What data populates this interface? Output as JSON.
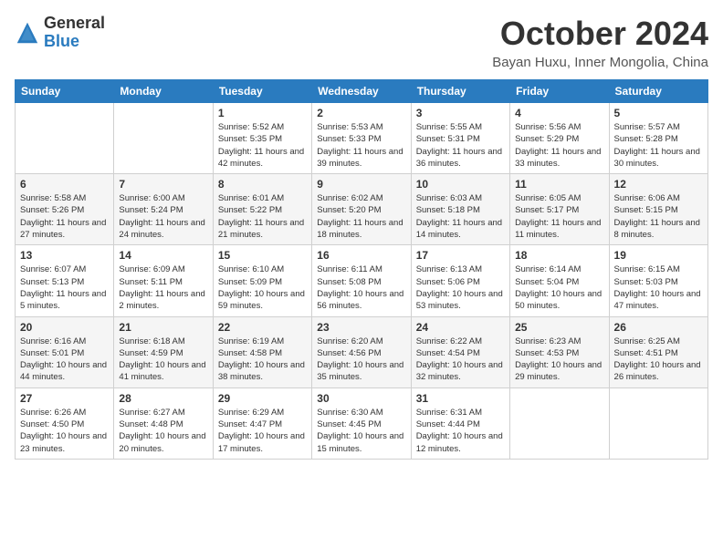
{
  "header": {
    "logo_general": "General",
    "logo_blue": "Blue",
    "month_title": "October 2024",
    "location": "Bayan Huxu, Inner Mongolia, China"
  },
  "weekdays": [
    "Sunday",
    "Monday",
    "Tuesday",
    "Wednesday",
    "Thursday",
    "Friday",
    "Saturday"
  ],
  "weeks": [
    [
      {
        "day": "",
        "info": ""
      },
      {
        "day": "",
        "info": ""
      },
      {
        "day": "1",
        "info": "Sunrise: 5:52 AM\nSunset: 5:35 PM\nDaylight: 11 hours and 42 minutes."
      },
      {
        "day": "2",
        "info": "Sunrise: 5:53 AM\nSunset: 5:33 PM\nDaylight: 11 hours and 39 minutes."
      },
      {
        "day": "3",
        "info": "Sunrise: 5:55 AM\nSunset: 5:31 PM\nDaylight: 11 hours and 36 minutes."
      },
      {
        "day": "4",
        "info": "Sunrise: 5:56 AM\nSunset: 5:29 PM\nDaylight: 11 hours and 33 minutes."
      },
      {
        "day": "5",
        "info": "Sunrise: 5:57 AM\nSunset: 5:28 PM\nDaylight: 11 hours and 30 minutes."
      }
    ],
    [
      {
        "day": "6",
        "info": "Sunrise: 5:58 AM\nSunset: 5:26 PM\nDaylight: 11 hours and 27 minutes."
      },
      {
        "day": "7",
        "info": "Sunrise: 6:00 AM\nSunset: 5:24 PM\nDaylight: 11 hours and 24 minutes."
      },
      {
        "day": "8",
        "info": "Sunrise: 6:01 AM\nSunset: 5:22 PM\nDaylight: 11 hours and 21 minutes."
      },
      {
        "day": "9",
        "info": "Sunrise: 6:02 AM\nSunset: 5:20 PM\nDaylight: 11 hours and 18 minutes."
      },
      {
        "day": "10",
        "info": "Sunrise: 6:03 AM\nSunset: 5:18 PM\nDaylight: 11 hours and 14 minutes."
      },
      {
        "day": "11",
        "info": "Sunrise: 6:05 AM\nSunset: 5:17 PM\nDaylight: 11 hours and 11 minutes."
      },
      {
        "day": "12",
        "info": "Sunrise: 6:06 AM\nSunset: 5:15 PM\nDaylight: 11 hours and 8 minutes."
      }
    ],
    [
      {
        "day": "13",
        "info": "Sunrise: 6:07 AM\nSunset: 5:13 PM\nDaylight: 11 hours and 5 minutes."
      },
      {
        "day": "14",
        "info": "Sunrise: 6:09 AM\nSunset: 5:11 PM\nDaylight: 11 hours and 2 minutes."
      },
      {
        "day": "15",
        "info": "Sunrise: 6:10 AM\nSunset: 5:09 PM\nDaylight: 10 hours and 59 minutes."
      },
      {
        "day": "16",
        "info": "Sunrise: 6:11 AM\nSunset: 5:08 PM\nDaylight: 10 hours and 56 minutes."
      },
      {
        "day": "17",
        "info": "Sunrise: 6:13 AM\nSunset: 5:06 PM\nDaylight: 10 hours and 53 minutes."
      },
      {
        "day": "18",
        "info": "Sunrise: 6:14 AM\nSunset: 5:04 PM\nDaylight: 10 hours and 50 minutes."
      },
      {
        "day": "19",
        "info": "Sunrise: 6:15 AM\nSunset: 5:03 PM\nDaylight: 10 hours and 47 minutes."
      }
    ],
    [
      {
        "day": "20",
        "info": "Sunrise: 6:16 AM\nSunset: 5:01 PM\nDaylight: 10 hours and 44 minutes."
      },
      {
        "day": "21",
        "info": "Sunrise: 6:18 AM\nSunset: 4:59 PM\nDaylight: 10 hours and 41 minutes."
      },
      {
        "day": "22",
        "info": "Sunrise: 6:19 AM\nSunset: 4:58 PM\nDaylight: 10 hours and 38 minutes."
      },
      {
        "day": "23",
        "info": "Sunrise: 6:20 AM\nSunset: 4:56 PM\nDaylight: 10 hours and 35 minutes."
      },
      {
        "day": "24",
        "info": "Sunrise: 6:22 AM\nSunset: 4:54 PM\nDaylight: 10 hours and 32 minutes."
      },
      {
        "day": "25",
        "info": "Sunrise: 6:23 AM\nSunset: 4:53 PM\nDaylight: 10 hours and 29 minutes."
      },
      {
        "day": "26",
        "info": "Sunrise: 6:25 AM\nSunset: 4:51 PM\nDaylight: 10 hours and 26 minutes."
      }
    ],
    [
      {
        "day": "27",
        "info": "Sunrise: 6:26 AM\nSunset: 4:50 PM\nDaylight: 10 hours and 23 minutes."
      },
      {
        "day": "28",
        "info": "Sunrise: 6:27 AM\nSunset: 4:48 PM\nDaylight: 10 hours and 20 minutes."
      },
      {
        "day": "29",
        "info": "Sunrise: 6:29 AM\nSunset: 4:47 PM\nDaylight: 10 hours and 17 minutes."
      },
      {
        "day": "30",
        "info": "Sunrise: 6:30 AM\nSunset: 4:45 PM\nDaylight: 10 hours and 15 minutes."
      },
      {
        "day": "31",
        "info": "Sunrise: 6:31 AM\nSunset: 4:44 PM\nDaylight: 10 hours and 12 minutes."
      },
      {
        "day": "",
        "info": ""
      },
      {
        "day": "",
        "info": ""
      }
    ]
  ]
}
